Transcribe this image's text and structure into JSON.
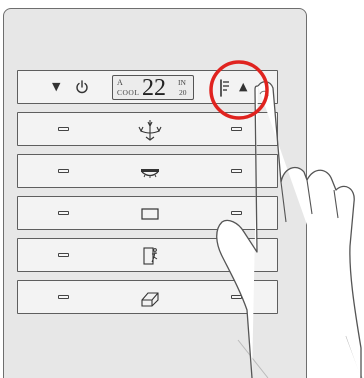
{
  "thermostat": {
    "mode_letter": "A",
    "mode": "COOL",
    "setpoint": "22",
    "indoor_label": "IN",
    "indoor_value": "20",
    "down_icon": "triangle-down-icon",
    "power_icon": "power-icon",
    "thermo_icon": "thermometer-icon",
    "up_icon": "triangle-up-icon",
    "down_glyph": "▼",
    "up_glyph": "▲"
  },
  "rows": [
    {
      "icon": "chandelier-icon"
    },
    {
      "icon": "ceiling-lamp-icon"
    },
    {
      "icon": "rectangle-icon"
    },
    {
      "icon": "exit-door-icon"
    },
    {
      "icon": "blind-icon"
    }
  ],
  "colors": {
    "highlight": "#e0231f",
    "plate": "#e7e7e7",
    "row_bg": "#f3f3f3",
    "stroke": "#444444"
  }
}
